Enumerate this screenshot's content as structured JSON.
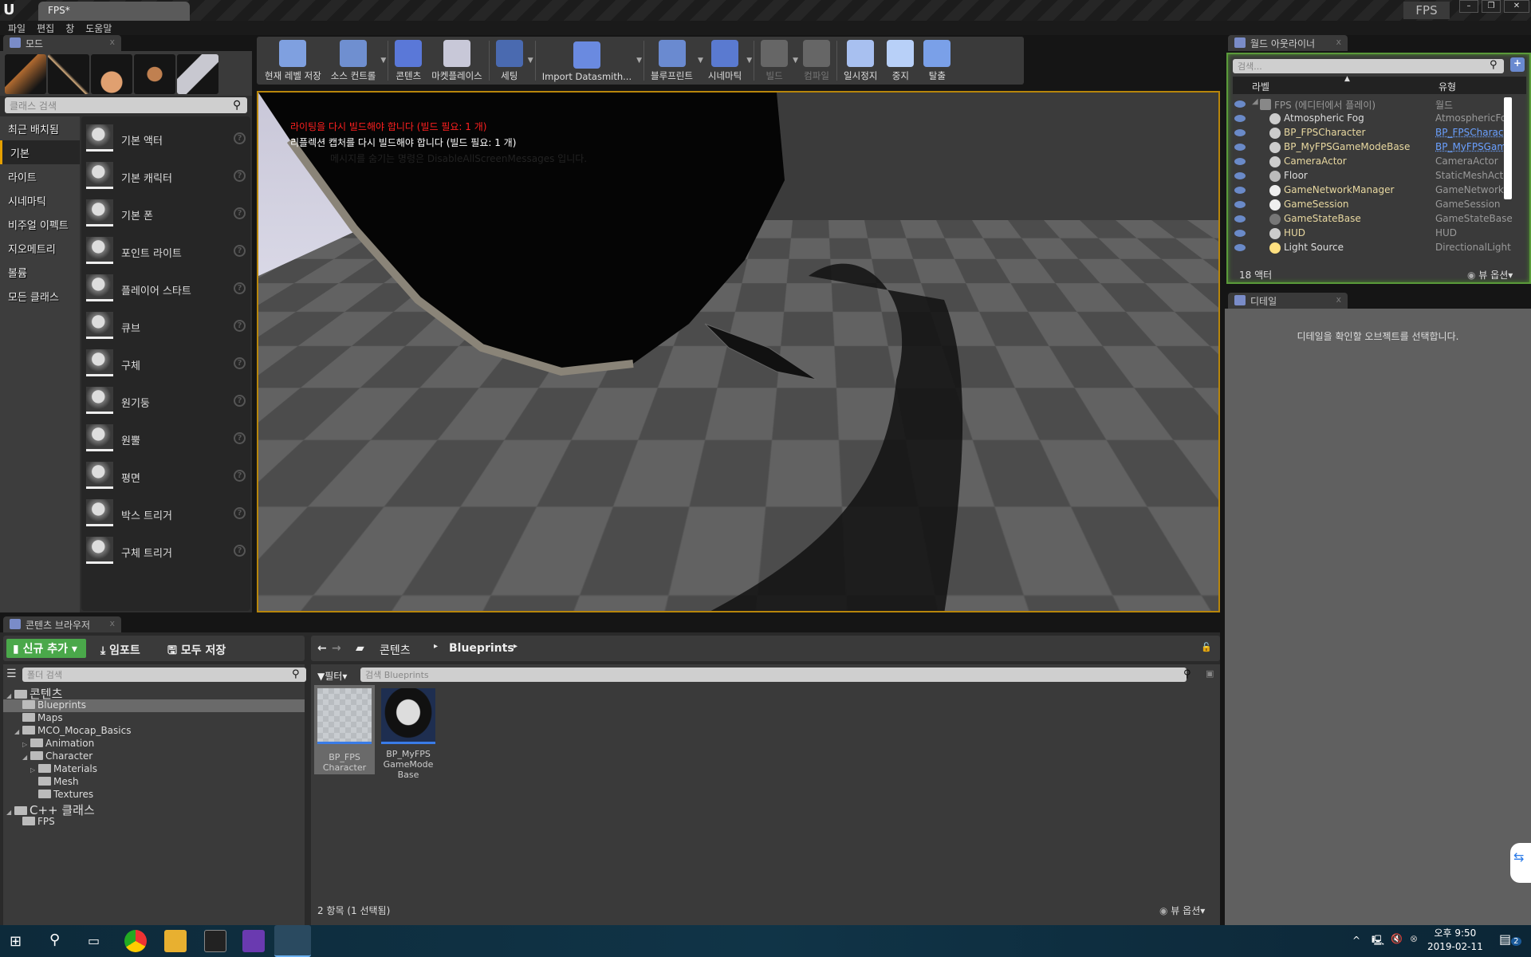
{
  "window": {
    "title": "FPS*",
    "project": "FPS"
  },
  "menu": [
    "파일",
    "편집",
    "창",
    "도움말"
  ],
  "modes": {
    "tab": "모드",
    "search_placeholder": "클래스 검색",
    "categories": [
      "최근 배치됨",
      "기본",
      "라이트",
      "시네마틱",
      "비주얼 이펙트",
      "지오메트리",
      "볼륨",
      "모든 클래스"
    ],
    "selected_category": "기본",
    "items": [
      "기본 액터",
      "기본 캐릭터",
      "기본 폰",
      "포인트 라이트",
      "플레이어 스타트",
      "큐브",
      "구체",
      "원기둥",
      "원뿔",
      "평면",
      "박스 트리거",
      "구체 트리거"
    ]
  },
  "toolbar": [
    {
      "label": "현재 레벨 저장",
      "icon": "save-icon",
      "color": "#7fa0e0"
    },
    {
      "label": "소스 컨트롤",
      "icon": "source-control-icon",
      "color": "#6f8fd0",
      "dropdown": true
    },
    {
      "label": "콘텐츠",
      "icon": "content-icon",
      "color": "#5a78d8"
    },
    {
      "label": "마켓플레이스",
      "icon": "marketplace-icon",
      "color": "#c8c8d8"
    },
    {
      "label": "세팅",
      "icon": "settings-icon",
      "color": "#4a6ab0",
      "dropdown": true
    },
    {
      "label": "Import Datasmith...",
      "icon": "datasmith-icon",
      "color": "#6a8ae0",
      "dropdown": true
    },
    {
      "label": "블루프린트",
      "icon": "blueprint-icon",
      "color": "#6a8ad0",
      "dropdown": true
    },
    {
      "label": "시네마틱",
      "icon": "cinematic-icon",
      "color": "#5a7ad0",
      "dropdown": true
    },
    {
      "label": "빌드",
      "icon": "build-icon",
      "color": "#666",
      "disabled": true,
      "dropdown": true
    },
    {
      "label": "컴파일",
      "icon": "compile-icon",
      "color": "#666",
      "disabled": true
    },
    {
      "label": "일시정지",
      "icon": "pause-icon",
      "color": "#a8c0f0"
    },
    {
      "label": "중지",
      "icon": "stop-icon",
      "color": "#b8d0f8"
    },
    {
      "label": "탈출",
      "icon": "eject-icon",
      "color": "#7aa0e8"
    }
  ],
  "viewport": {
    "messages": [
      "라이팅을 다시 빌드해야 합니다 (빌드 필요: 1 개)",
      "리플렉션 캡처를 다시 빌드해야 합니다 (빌드 필요: 1 개)",
      "메시지를 숨기는 명령은 DisableAllScreenMessages 입니다."
    ]
  },
  "outliner": {
    "tab": "월드 아웃라이너",
    "search_placeholder": "검색...",
    "col_label": "라벨",
    "col_type": "유형",
    "root": {
      "name": "FPS (에디터에서 플레이)",
      "type": "월드"
    },
    "rows": [
      {
        "name": "Atmospheric Fog",
        "type": "AtmosphericFog"
      },
      {
        "name": "BP_FPSCharacter",
        "type": "BP_FPSCharacter",
        "link": true
      },
      {
        "name": "BP_MyFPSGameModeBase",
        "type": "BP_MyFPSGameModeBase",
        "link": true
      },
      {
        "name": "CameraActor",
        "type": "CameraActor"
      },
      {
        "name": "Floor",
        "type": "StaticMeshActor"
      },
      {
        "name": "GameNetworkManager",
        "type": "GameNetworkManager"
      },
      {
        "name": "GameSession",
        "type": "GameSession"
      },
      {
        "name": "GameStateBase",
        "type": "GameStateBase"
      },
      {
        "name": "HUD",
        "type": "HUD"
      },
      {
        "name": "Light Source",
        "type": "DirectionalLight"
      }
    ],
    "count": "18 액터",
    "view_options": "뷰 옵션"
  },
  "details": {
    "tab": "디테일",
    "empty_message": "디테일을 확인할 오브젝트를 선택합니다."
  },
  "content_browser": {
    "tab": "콘텐츠 브라우저",
    "add_new": "신규 추가",
    "import": "임포트",
    "save_all": "모두 저장",
    "path": [
      "콘텐츠",
      "Blueprints"
    ],
    "folder_search_placeholder": "폴더 검색",
    "filter": "필터",
    "asset_search_placeholder": "검색 Blueprints",
    "tree": [
      {
        "label": "콘텐츠",
        "depth": 0,
        "big": true,
        "arrow": "◢"
      },
      {
        "label": "Blueprints",
        "depth": 1,
        "selected": true
      },
      {
        "label": "Maps",
        "depth": 1
      },
      {
        "label": "MCO_Mocap_Basics",
        "depth": 1,
        "arrow": "◢"
      },
      {
        "label": "Animation",
        "depth": 2,
        "arrow": "▷"
      },
      {
        "label": "Character",
        "depth": 2,
        "arrow": "◢"
      },
      {
        "label": "Materials",
        "depth": 3,
        "arrow": "▷"
      },
      {
        "label": "Mesh",
        "depth": 3
      },
      {
        "label": "Textures",
        "depth": 3
      },
      {
        "label": "C++ 클래스",
        "depth": 0,
        "big": true,
        "arrow": "◢"
      },
      {
        "label": "FPS",
        "depth": 1
      }
    ],
    "assets": [
      {
        "name": "BP_FPS Character",
        "selected": true
      },
      {
        "name": "BP_MyFPS GameMode Base"
      }
    ],
    "status": "2 항목 (1 선택됨)",
    "view_options": "뷰 옵션"
  },
  "taskbar": {
    "time": "오후 9:50",
    "date": "2019-02-11",
    "notifications": "2"
  }
}
